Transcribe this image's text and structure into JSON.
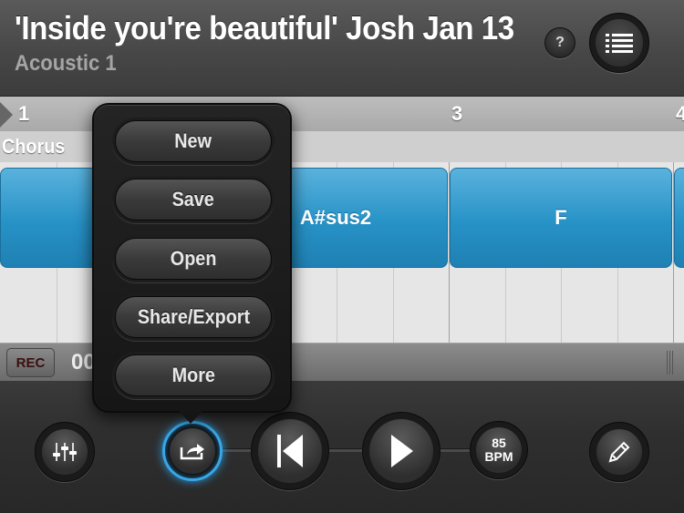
{
  "header": {
    "song_title": "'Inside you're beautiful' Josh Jan 13",
    "track_name": "Acoustic 1",
    "help_label": "?"
  },
  "timeline": {
    "bar_numbers": [
      "1",
      "3",
      "4"
    ],
    "section_label": "Chorus",
    "chords": [
      "A#sus2",
      "F"
    ]
  },
  "status": {
    "rec_label": "REC",
    "time_readout": "00"
  },
  "menu": {
    "items": [
      "New",
      "Save",
      "Open",
      "Share/Export",
      "More"
    ]
  },
  "toolbar": {
    "bpm_value": "85",
    "bpm_unit": "BPM"
  },
  "colors": {
    "chord_block": "#2792c6",
    "share_highlight": "#39a6e6"
  },
  "icons": [
    "help-icon",
    "list-icon",
    "mixer-icon",
    "share-icon",
    "rewind-icon",
    "play-icon",
    "pencil-icon"
  ]
}
